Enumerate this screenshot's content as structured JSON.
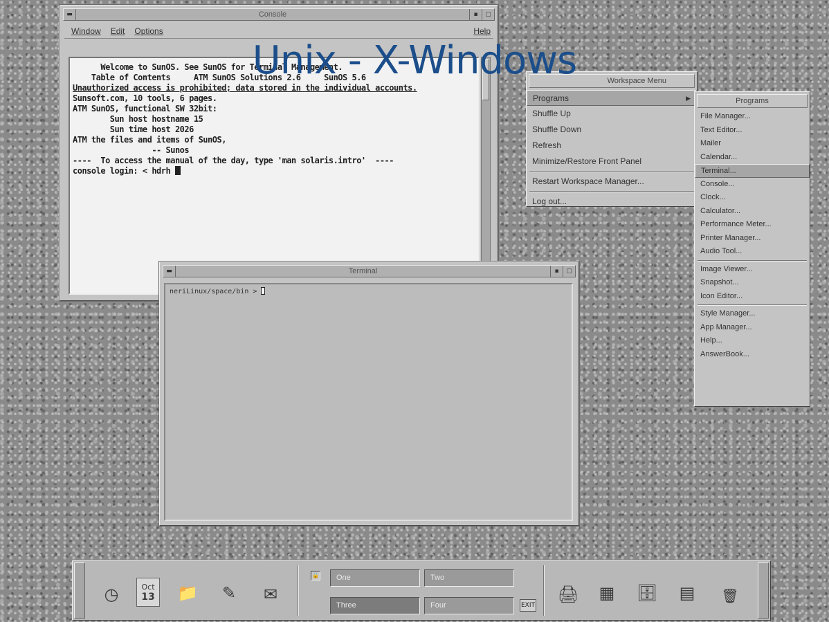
{
  "slide_title": "Unix - X-Windows",
  "console": {
    "title": "Console",
    "menu": [
      "Window",
      "Edit",
      "Options"
    ],
    "help": "Help",
    "lines": [
      "      Welcome to SunOS. See SunOS for Terminal Management.",
      "    Table of Contents     ATM SunOS Solutions 2.6     SunOS 5.6",
      "Unauthorized access is prohibited; data stored in the individual accounts.",
      "",
      "Sunsoft.com, 10 tools, 6 pages.",
      "ATM SunOS, functional SW 32bit:",
      "        Sun host hostname 15",
      "        Sun time host 2026",
      "ATM the files and items of SunOS,",
      "                 -- Sunos",
      "",
      "----  To access the manual of the day, type 'man solaris.intro'  ----",
      "",
      "console login: < hdrh"
    ]
  },
  "terminal": {
    "title": "Terminal",
    "prompt": "neriLinux/space/bin > "
  },
  "workspace_menu": {
    "title": "Workspace Menu",
    "items": [
      "Programs",
      "Shuffle Up",
      "Shuffle Down",
      "Refresh",
      "Minimize/Restore Front Panel",
      "Restart Workspace Manager...",
      "Log out..."
    ]
  },
  "programs_menu": {
    "title": "Programs",
    "items": [
      "File Manager...",
      "Text Editor...",
      "Mailer",
      "Calendar...",
      "Terminal...",
      "Console...",
      "Clock...",
      "Calculator...",
      "Performance Meter...",
      "Printer Manager...",
      "Audio Tool...",
      "Image Viewer...",
      "Snapshot...",
      "Icon Editor...",
      "Style Manager...",
      "App Manager...",
      "Help...",
      "AnswerBook..."
    ]
  },
  "front_panel": {
    "workspaces": [
      "One",
      "Two",
      "Three",
      "Four"
    ],
    "calendar_month": "Oct",
    "calendar_day": "13",
    "exit_label": "EXIT"
  },
  "colors": {
    "title_accent": "#1b4e8a",
    "desktop": "#8a8a8a",
    "window": "#c4c4c4"
  }
}
